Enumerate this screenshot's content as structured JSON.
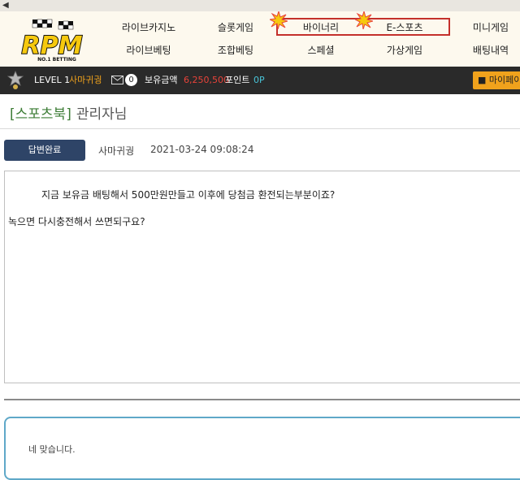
{
  "logo": {
    "text": "RPM",
    "tagline": "NO.1 BETTING"
  },
  "nav": {
    "row1": [
      "라이브카지노",
      "슬롯게임",
      "바이너리",
      "E-스포츠",
      "미니게임"
    ],
    "row2": [
      "라이브베팅",
      "조합베팅",
      "스페셜",
      "가상게임",
      "배팅내역"
    ]
  },
  "userbar": {
    "level": "LEVEL 1",
    "username": "사마귀궝",
    "message_count": "0",
    "balance_label": "보유금액",
    "balance_value": "6,250,500",
    "points_label": "포인트",
    "points_value": "0P",
    "mypage_label": "마이페이"
  },
  "post": {
    "category": "[스포츠북]",
    "to": "관리자님",
    "status_badge": "답변완료",
    "author": "사마귀궝",
    "datetime": "2021-03-24 09:08:24",
    "body_line1": "지금 보유금 배팅해서 500만원만들고 이후에 당첨금 환전되는부분이죠?",
    "body_line2": "녹으면 다시충전해서 쓰면되구요?"
  },
  "reply": {
    "text": "네 맞습니다."
  },
  "colors": {
    "header_bg": "#fdf9ee",
    "userbar_bg": "#2a2a2a",
    "badge_bg": "#2e4467",
    "category_green": "#3d7d36",
    "balance_red": "#e8433a",
    "points_cyan": "#49c4d8",
    "username_orange": "#f0a21c",
    "highlight_box": "#c4302b",
    "reply_border": "#5fa8c8"
  }
}
